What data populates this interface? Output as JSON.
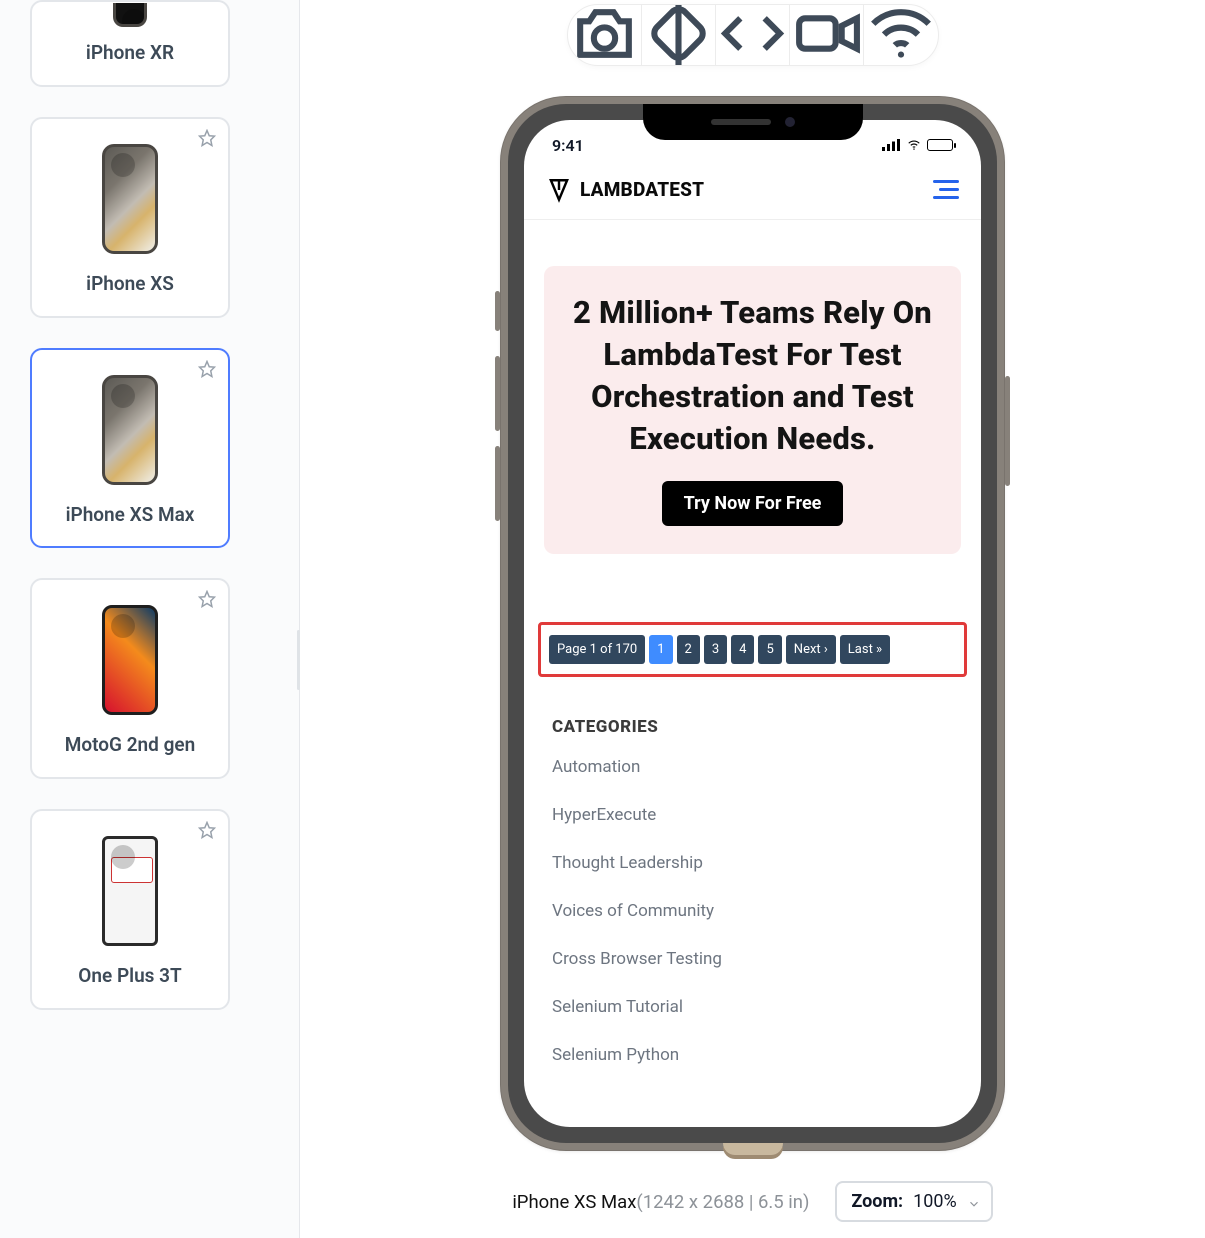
{
  "sidebar": {
    "devices": [
      {
        "label": "iPhone XR",
        "kind": "iphone-xr",
        "selected": false,
        "partial_top": true
      },
      {
        "label": "iPhone XS",
        "kind": "iphone-xs",
        "selected": false,
        "partial_top": false
      },
      {
        "label": "iPhone XS Max",
        "kind": "iphone-xs-max",
        "selected": true,
        "partial_top": false
      },
      {
        "label": "MotoG 2nd gen",
        "kind": "moto-g2",
        "selected": false,
        "partial_top": false
      },
      {
        "label": "One Plus 3T",
        "kind": "oneplus-3t",
        "selected": false,
        "partial_top": false
      }
    ]
  },
  "toolbar": {
    "items": [
      {
        "name": "camera-icon"
      },
      {
        "name": "rotate-icon"
      },
      {
        "name": "devtools-icon"
      },
      {
        "name": "video-icon"
      },
      {
        "name": "wifi-icon"
      }
    ]
  },
  "preview": {
    "status_time": "9:41",
    "brand": "LAMBDATEST",
    "hero_text": "2 Million+ Teams Rely On LambdaTest For Test Orchestration and Test Execution Needs.",
    "cta_label": "Try Now For Free",
    "pagination": {
      "info": "Page 1 of 170",
      "pages": [
        "1",
        "2",
        "3",
        "4",
        "5"
      ],
      "active_index": 0,
      "next_label": "Next ›",
      "last_label": "Last »"
    },
    "categories_heading": "CATEGORIES",
    "categories": [
      "Automation",
      "HyperExecute",
      "Thought Leadership",
      "Voices of Community",
      "Cross Browser Testing",
      "Selenium Tutorial",
      "Selenium Python"
    ]
  },
  "footer": {
    "device_name": "iPhone XS Max",
    "device_dims": "(1242 x 2688 | 6.5 in)",
    "zoom_label": "Zoom:",
    "zoom_value": "100%"
  }
}
